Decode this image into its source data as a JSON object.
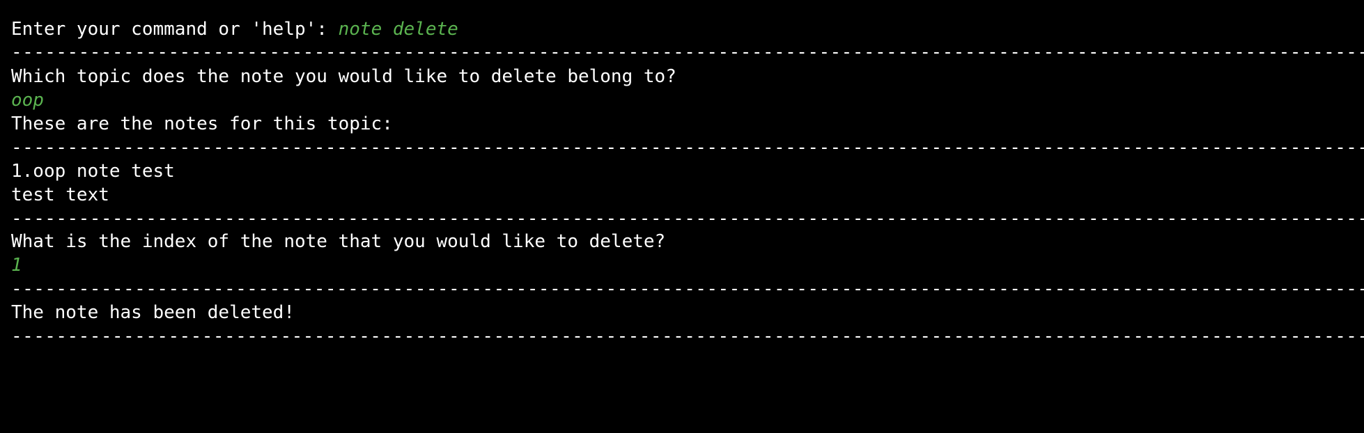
{
  "separator": "-----------------------------------------------------------------------------------------------------------------------------------------------------------------------------------------------------------",
  "lines": {
    "prompt_label": "Enter your command or 'help': ",
    "prompt_input": "note delete",
    "q_topic": "Which topic does the note you would like to delete belong to?",
    "topic_input": "oop",
    "notes_header": "These are the notes for this topic:",
    "note_title": "1.oop note test",
    "note_body": "test text",
    "q_index": "What is the index of the note that you would like to delete?",
    "index_input": "1",
    "result": "The note has been deleted!"
  },
  "colors": {
    "background": "#000000",
    "text": "#ffffff",
    "input": "#5bb450"
  }
}
